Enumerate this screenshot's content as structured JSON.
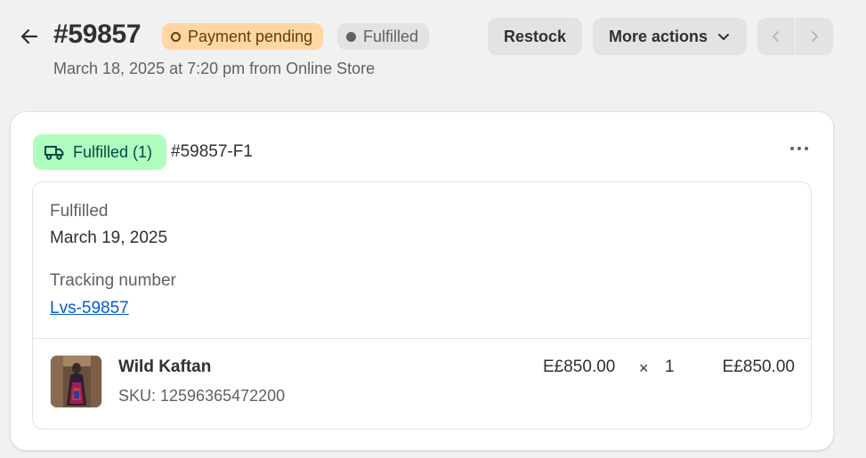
{
  "header": {
    "order_number": "#59857",
    "payment_badge": "Payment pending",
    "fulfillment_badge": "Fulfilled",
    "subtitle": "March 18, 2025 at 7:20 pm from Online Store",
    "restock_label": "Restock",
    "more_actions_label": "More actions",
    "icons": {
      "back": "arrow-left-icon",
      "chevron": "chevron-down-icon",
      "prev": "chevron-left-icon",
      "next": "chevron-right-icon"
    }
  },
  "fulfillment": {
    "status_chip": "Fulfilled (1)",
    "status_icon": "delivery-truck-icon",
    "id": "#59857-F1",
    "menu_icon": "ellipsis-icon",
    "fulfilled_label": "Fulfilled",
    "fulfilled_date": "March 19, 2025",
    "tracking_label": "Tracking number",
    "tracking_number": "Lvs-59857",
    "item": {
      "name": "Wild Kaftan",
      "sku": "SKU: 12596365472200",
      "unit_price": "E£850.00",
      "times": "×",
      "quantity": "1",
      "total": "E£850.00"
    }
  },
  "colors": {
    "background": "#f1f1f1",
    "payment_pending_bg": "#ffd6a4",
    "fulfilled_chip_bg": "#affebf",
    "link": "#005bd3"
  }
}
